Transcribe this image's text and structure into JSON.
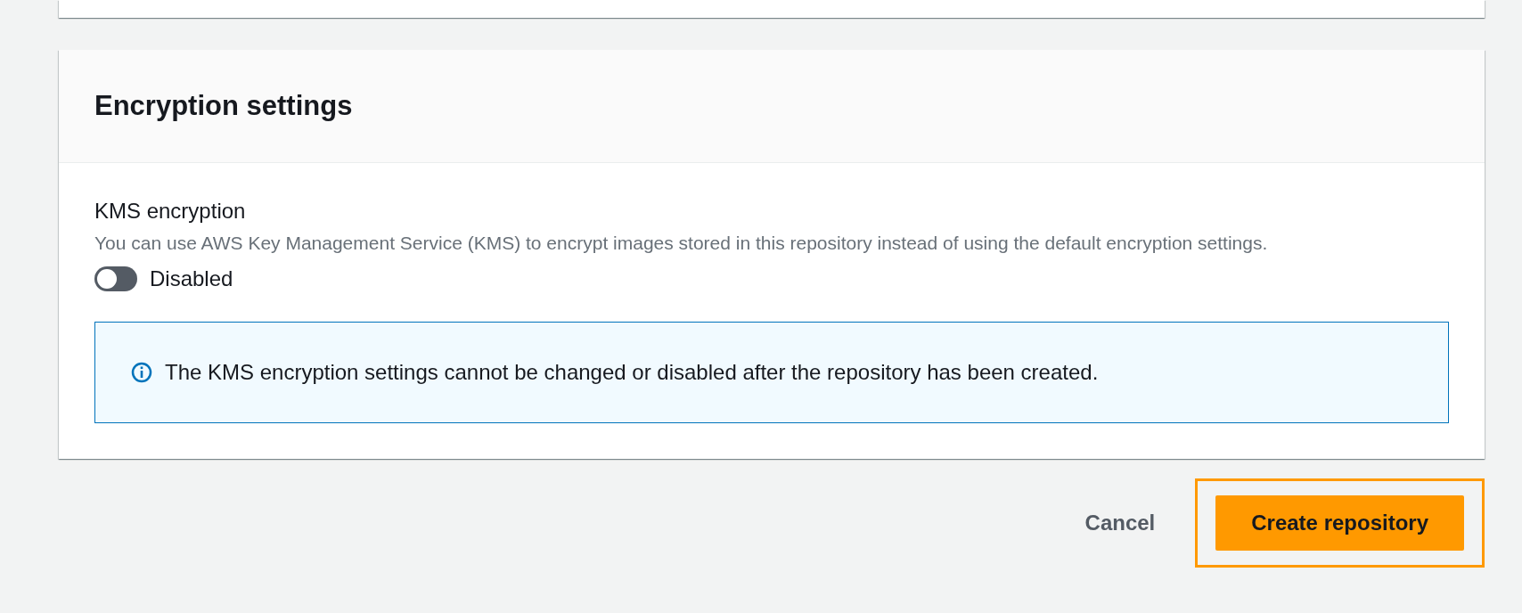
{
  "section": {
    "title": "Encryption settings"
  },
  "field": {
    "label": "KMS encryption",
    "description": "You can use AWS Key Management Service (KMS) to encrypt images stored in this repository instead of using the default encryption settings."
  },
  "toggle": {
    "label": "Disabled",
    "checked": false
  },
  "info_alert": {
    "text": "The KMS encryption settings cannot be changed or disabled after the repository has been created."
  },
  "buttons": [
    {
      "label": "Cancel",
      "kind": "link",
      "highlighted": false
    },
    {
      "label": "Create repository",
      "kind": "primary",
      "highlighted": true
    }
  ]
}
